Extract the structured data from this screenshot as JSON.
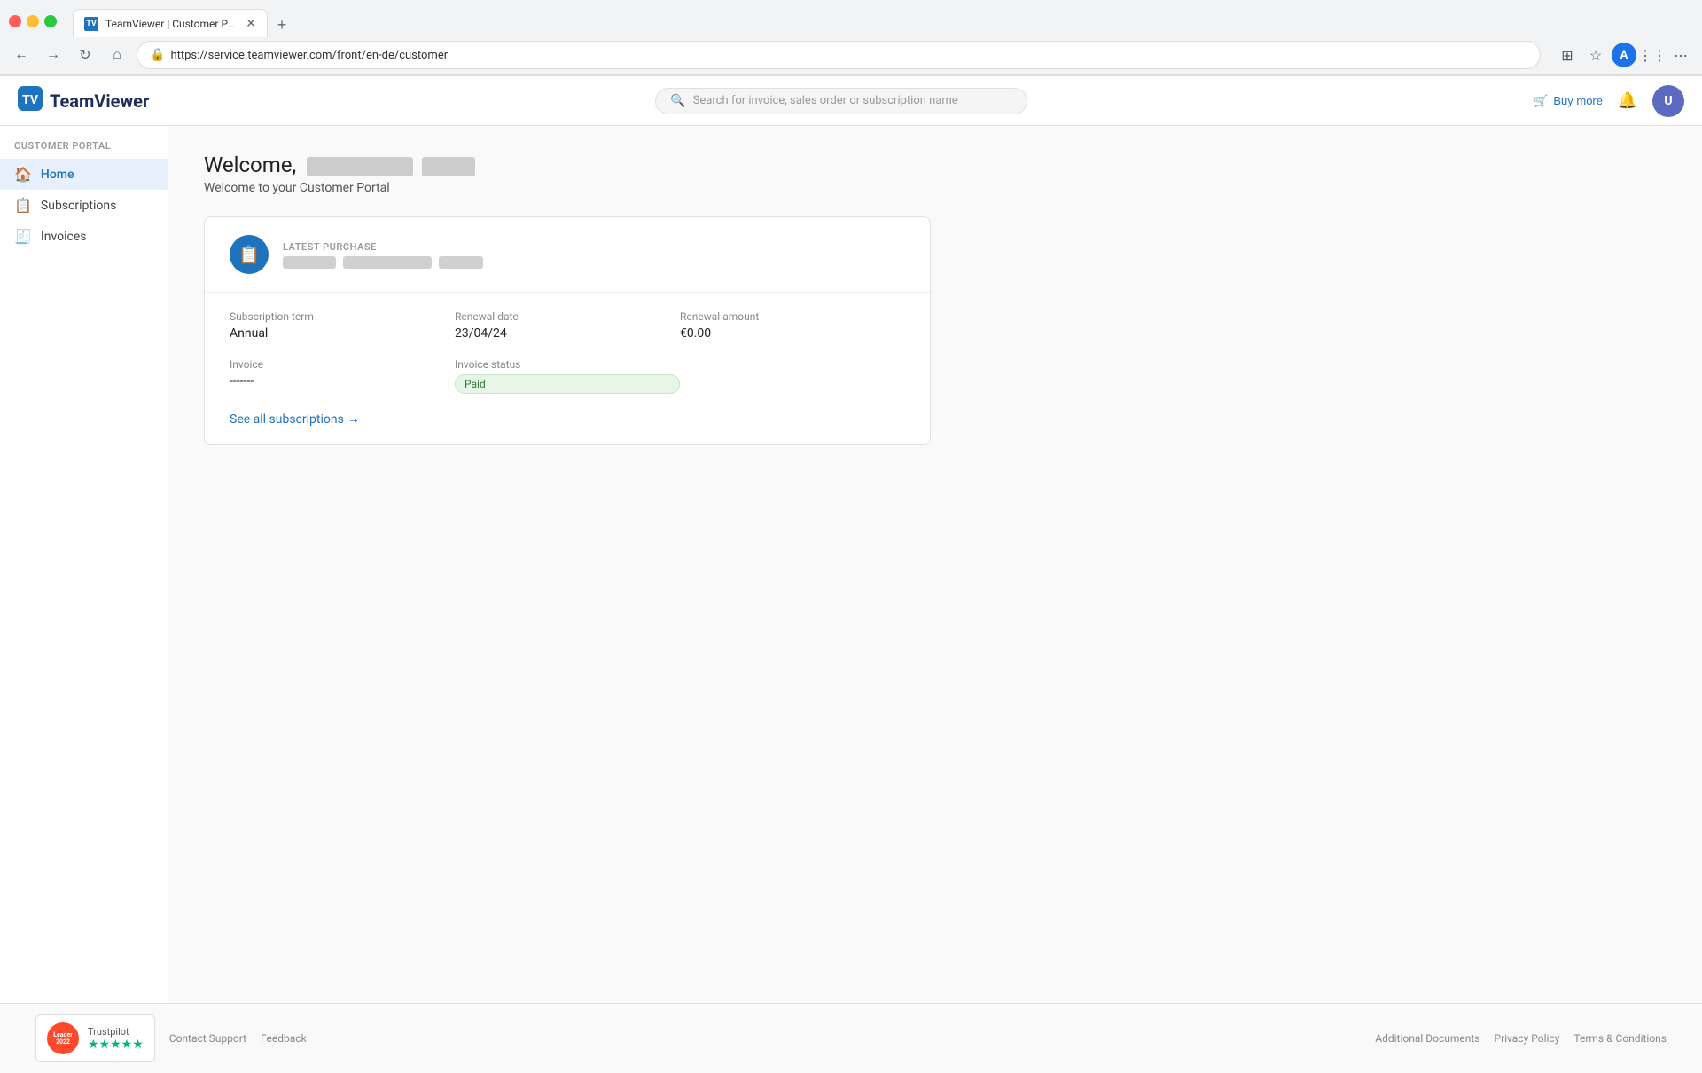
{
  "browser": {
    "tab_title": "TeamViewer | Customer Portal",
    "tab_favicon": "TV",
    "address": "https://service.teamviewer.com/front/en-de/customer",
    "new_tab_label": "+",
    "nav": {
      "back": "←",
      "forward": "→",
      "refresh": "↻",
      "home": "⌂"
    }
  },
  "header": {
    "logo_text": "TeamViewer",
    "search_placeholder": "Search for invoice, sales order or subscription name",
    "buy_more_label": "Buy more",
    "notification_icon": "🔔",
    "user_initials": "U"
  },
  "sidebar": {
    "section_label": "CUSTOMER PORTAL",
    "items": [
      {
        "id": "home",
        "label": "Home",
        "icon": "🏠",
        "active": true
      },
      {
        "id": "subscriptions",
        "label": "Subscriptions",
        "icon": "📋",
        "active": false
      },
      {
        "id": "invoices",
        "label": "Invoices",
        "icon": "🧾",
        "active": false
      }
    ]
  },
  "main": {
    "welcome_title": "Welcome,",
    "welcome_subtitle": "Welcome to your Customer Portal",
    "card": {
      "latest_purchase_label": "LATEST PURCHASE",
      "purchase_icon": "📋",
      "subscription_term_label": "Subscription term",
      "subscription_term_value": "Annual",
      "renewal_date_label": "Renewal date",
      "renewal_date_value": "23/04/24",
      "renewal_amount_label": "Renewal amount",
      "renewal_amount_value": "€0.00",
      "invoice_label": "Invoice",
      "invoice_value": "-------",
      "invoice_status_label": "Invoice status",
      "invoice_status_value": "Paid",
      "see_all_label": "See all subscriptions",
      "see_all_arrow": "→"
    }
  },
  "footer": {
    "contact_support": "Contact Support",
    "feedback": "Feedback",
    "additional_documents": "Additional Documents",
    "privacy_policy": "Privacy Policy",
    "terms": "Terms & Conditions"
  },
  "trustpilot": {
    "g2_label": "Leader",
    "g2_year": "2022",
    "stars": "★★★★★",
    "brand": "Trustpilot"
  }
}
